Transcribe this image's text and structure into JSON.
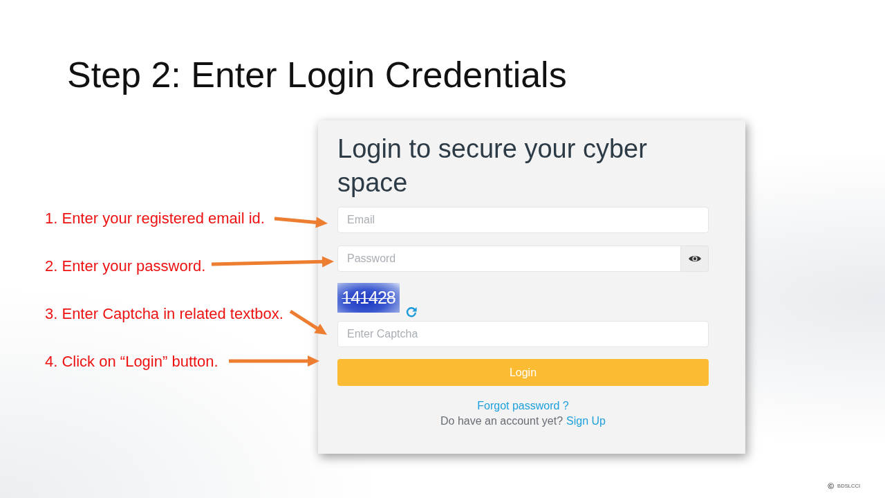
{
  "slide": {
    "title": "Step 2: Enter Login Credentials"
  },
  "steps": [
    {
      "text": "1. Enter your registered email id."
    },
    {
      "text": "2. Enter your password."
    },
    {
      "text": "3. Enter Captcha in related textbox."
    },
    {
      "text": "4. Click on “Login” button."
    }
  ],
  "login_form": {
    "heading": "Login to secure your cyber space",
    "fields": [
      {
        "kind": "email",
        "placeholder": "Email"
      },
      {
        "kind": "password",
        "placeholder": "Password"
      },
      {
        "kind": "captcha",
        "code": "141428",
        "placeholder": "Enter Captcha"
      }
    ],
    "button": "Login",
    "forgot_link": "Forgot password ?",
    "signup_prompt": "Do have an account yet?",
    "signup_link": "Sign Up"
  },
  "footer": {
    "copyright_symbol": "©",
    "owner": "BDSLCCI"
  }
}
